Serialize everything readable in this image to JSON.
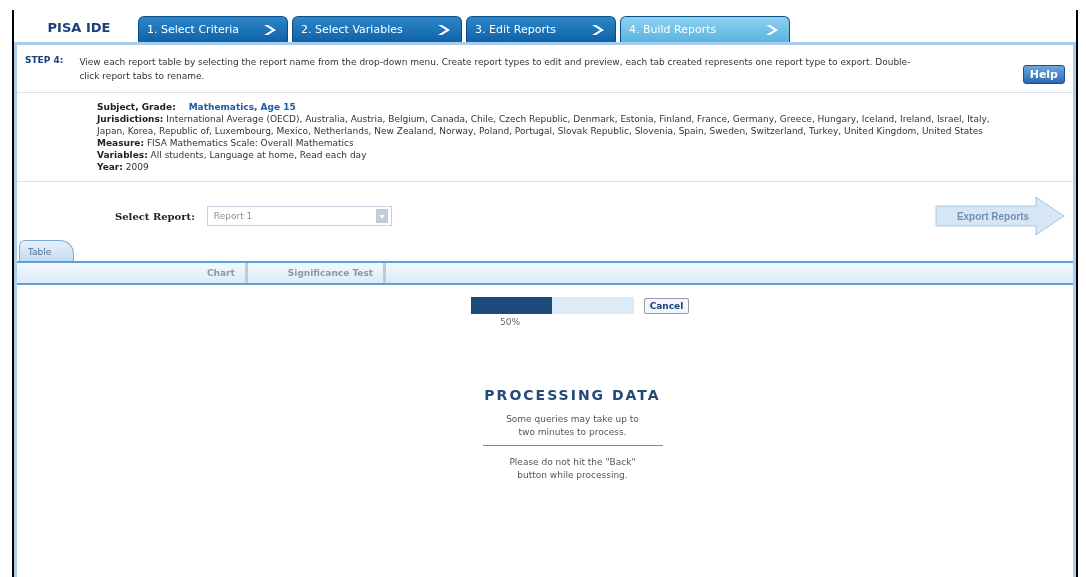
{
  "app_title": "PISA IDE",
  "steps": [
    {
      "label": "1. Select Criteria",
      "selected": false
    },
    {
      "label": "2. Select Variables",
      "selected": false
    },
    {
      "label": "3. Edit Reports",
      "selected": false
    },
    {
      "label": "4. Build Reports",
      "selected": true
    }
  ],
  "instructions": {
    "step": "STEP 4:",
    "text": "View each report table by selecting the report name from the drop-down menu. Create report types to edit and preview, each tab created represents one report type to export. Double-click report tabs to rename.",
    "help": "Help"
  },
  "criteria": [
    {
      "label": "Subject, Grade:",
      "value": "Mathematics, Age 15",
      "highlight": true
    },
    {
      "label": "Jurisdictions:",
      "value": "International Average (OECD), Australia, Austria, Belgium, Canada, Chile, Czech Republic, Denmark, Estonia, Finland, France, Germany, Greece, Hungary, Iceland, Ireland, Israel, Italy, Japan, Korea, Republic of, Luxembourg, Mexico, Netherlands, New Zealand, Norway, Poland, Portugal, Slovak Republic, Slovenia, Spain, Sweden, Switzerland, Turkey, United Kingdom, United States",
      "highlight": false
    },
    {
      "label": "Measure:",
      "value": "FISA Mathematics Scale: Overall Mathematics",
      "highlight": false
    },
    {
      "label": "Variables:",
      "value": "All students, Language at home, Read each day",
      "highlight": false
    },
    {
      "label": "Year:",
      "value": "2009",
      "highlight": false
    }
  ],
  "select_report": {
    "label": "Select Report:",
    "value": "Report 1",
    "disabled": true
  },
  "export_button": {
    "label": "Export Reports",
    "disabled": true
  },
  "report_tabs": [
    {
      "label": "Table",
      "selected": true
    }
  ],
  "view_tabs": [
    {
      "label": "Chart"
    },
    {
      "label": "Significance Test"
    }
  ],
  "progress": {
    "level": 0.5,
    "reading": "50%",
    "cancel": "Cancel"
  },
  "processing": {
    "title": "PROCESSING DATA",
    "message": "Some queries may take up to two minutes to process.",
    "warning": "Please do not hit the \"Back\" button while processing."
  }
}
